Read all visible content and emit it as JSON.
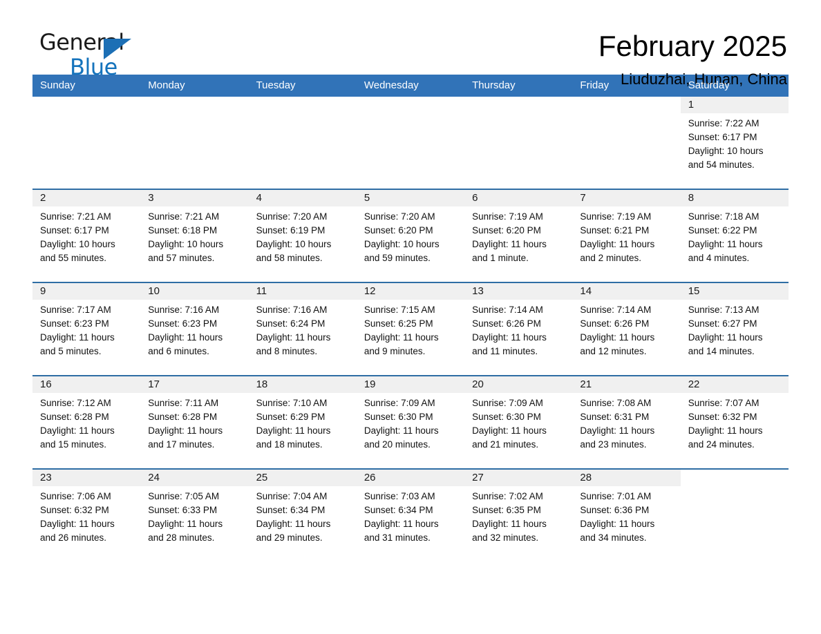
{
  "brand": {
    "name_part1": "General",
    "name_part2": "Blue",
    "accent_color": "#1473bc",
    "logo_icon": "triangle-icon"
  },
  "header": {
    "title": "February 2025",
    "subtitle": "Liuduzhai, Hunan, China"
  },
  "calendar": {
    "header_bg": "#3173b8",
    "row_border": "#2e6da4",
    "daynum_band_bg": "#f0f0f0",
    "weekday_headers": [
      "Sunday",
      "Monday",
      "Tuesday",
      "Wednesday",
      "Thursday",
      "Friday",
      "Saturday"
    ],
    "weeks": [
      [
        {
          "day": "",
          "lines": []
        },
        {
          "day": "",
          "lines": []
        },
        {
          "day": "",
          "lines": []
        },
        {
          "day": "",
          "lines": []
        },
        {
          "day": "",
          "lines": []
        },
        {
          "day": "",
          "lines": []
        },
        {
          "day": "1",
          "lines": [
            "Sunrise: 7:22 AM",
            "Sunset: 6:17 PM",
            "Daylight: 10 hours",
            "and 54 minutes."
          ]
        }
      ],
      [
        {
          "day": "2",
          "lines": [
            "Sunrise: 7:21 AM",
            "Sunset: 6:17 PM",
            "Daylight: 10 hours",
            "and 55 minutes."
          ]
        },
        {
          "day": "3",
          "lines": [
            "Sunrise: 7:21 AM",
            "Sunset: 6:18 PM",
            "Daylight: 10 hours",
            "and 57 minutes."
          ]
        },
        {
          "day": "4",
          "lines": [
            "Sunrise: 7:20 AM",
            "Sunset: 6:19 PM",
            "Daylight: 10 hours",
            "and 58 minutes."
          ]
        },
        {
          "day": "5",
          "lines": [
            "Sunrise: 7:20 AM",
            "Sunset: 6:20 PM",
            "Daylight: 10 hours",
            "and 59 minutes."
          ]
        },
        {
          "day": "6",
          "lines": [
            "Sunrise: 7:19 AM",
            "Sunset: 6:20 PM",
            "Daylight: 11 hours",
            "and 1 minute."
          ]
        },
        {
          "day": "7",
          "lines": [
            "Sunrise: 7:19 AM",
            "Sunset: 6:21 PM",
            "Daylight: 11 hours",
            "and 2 minutes."
          ]
        },
        {
          "day": "8",
          "lines": [
            "Sunrise: 7:18 AM",
            "Sunset: 6:22 PM",
            "Daylight: 11 hours",
            "and 4 minutes."
          ]
        }
      ],
      [
        {
          "day": "9",
          "lines": [
            "Sunrise: 7:17 AM",
            "Sunset: 6:23 PM",
            "Daylight: 11 hours",
            "and 5 minutes."
          ]
        },
        {
          "day": "10",
          "lines": [
            "Sunrise: 7:16 AM",
            "Sunset: 6:23 PM",
            "Daylight: 11 hours",
            "and 6 minutes."
          ]
        },
        {
          "day": "11",
          "lines": [
            "Sunrise: 7:16 AM",
            "Sunset: 6:24 PM",
            "Daylight: 11 hours",
            "and 8 minutes."
          ]
        },
        {
          "day": "12",
          "lines": [
            "Sunrise: 7:15 AM",
            "Sunset: 6:25 PM",
            "Daylight: 11 hours",
            "and 9 minutes."
          ]
        },
        {
          "day": "13",
          "lines": [
            "Sunrise: 7:14 AM",
            "Sunset: 6:26 PM",
            "Daylight: 11 hours",
            "and 11 minutes."
          ]
        },
        {
          "day": "14",
          "lines": [
            "Sunrise: 7:14 AM",
            "Sunset: 6:26 PM",
            "Daylight: 11 hours",
            "and 12 minutes."
          ]
        },
        {
          "day": "15",
          "lines": [
            "Sunrise: 7:13 AM",
            "Sunset: 6:27 PM",
            "Daylight: 11 hours",
            "and 14 minutes."
          ]
        }
      ],
      [
        {
          "day": "16",
          "lines": [
            "Sunrise: 7:12 AM",
            "Sunset: 6:28 PM",
            "Daylight: 11 hours",
            "and 15 minutes."
          ]
        },
        {
          "day": "17",
          "lines": [
            "Sunrise: 7:11 AM",
            "Sunset: 6:28 PM",
            "Daylight: 11 hours",
            "and 17 minutes."
          ]
        },
        {
          "day": "18",
          "lines": [
            "Sunrise: 7:10 AM",
            "Sunset: 6:29 PM",
            "Daylight: 11 hours",
            "and 18 minutes."
          ]
        },
        {
          "day": "19",
          "lines": [
            "Sunrise: 7:09 AM",
            "Sunset: 6:30 PM",
            "Daylight: 11 hours",
            "and 20 minutes."
          ]
        },
        {
          "day": "20",
          "lines": [
            "Sunrise: 7:09 AM",
            "Sunset: 6:30 PM",
            "Daylight: 11 hours",
            "and 21 minutes."
          ]
        },
        {
          "day": "21",
          "lines": [
            "Sunrise: 7:08 AM",
            "Sunset: 6:31 PM",
            "Daylight: 11 hours",
            "and 23 minutes."
          ]
        },
        {
          "day": "22",
          "lines": [
            "Sunrise: 7:07 AM",
            "Sunset: 6:32 PM",
            "Daylight: 11 hours",
            "and 24 minutes."
          ]
        }
      ],
      [
        {
          "day": "23",
          "lines": [
            "Sunrise: 7:06 AM",
            "Sunset: 6:32 PM",
            "Daylight: 11 hours",
            "and 26 minutes."
          ]
        },
        {
          "day": "24",
          "lines": [
            "Sunrise: 7:05 AM",
            "Sunset: 6:33 PM",
            "Daylight: 11 hours",
            "and 28 minutes."
          ]
        },
        {
          "day": "25",
          "lines": [
            "Sunrise: 7:04 AM",
            "Sunset: 6:34 PM",
            "Daylight: 11 hours",
            "and 29 minutes."
          ]
        },
        {
          "day": "26",
          "lines": [
            "Sunrise: 7:03 AM",
            "Sunset: 6:34 PM",
            "Daylight: 11 hours",
            "and 31 minutes."
          ]
        },
        {
          "day": "27",
          "lines": [
            "Sunrise: 7:02 AM",
            "Sunset: 6:35 PM",
            "Daylight: 11 hours",
            "and 32 minutes."
          ]
        },
        {
          "day": "28",
          "lines": [
            "Sunrise: 7:01 AM",
            "Sunset: 6:36 PM",
            "Daylight: 11 hours",
            "and 34 minutes."
          ]
        },
        {
          "day": "",
          "lines": []
        }
      ]
    ]
  }
}
